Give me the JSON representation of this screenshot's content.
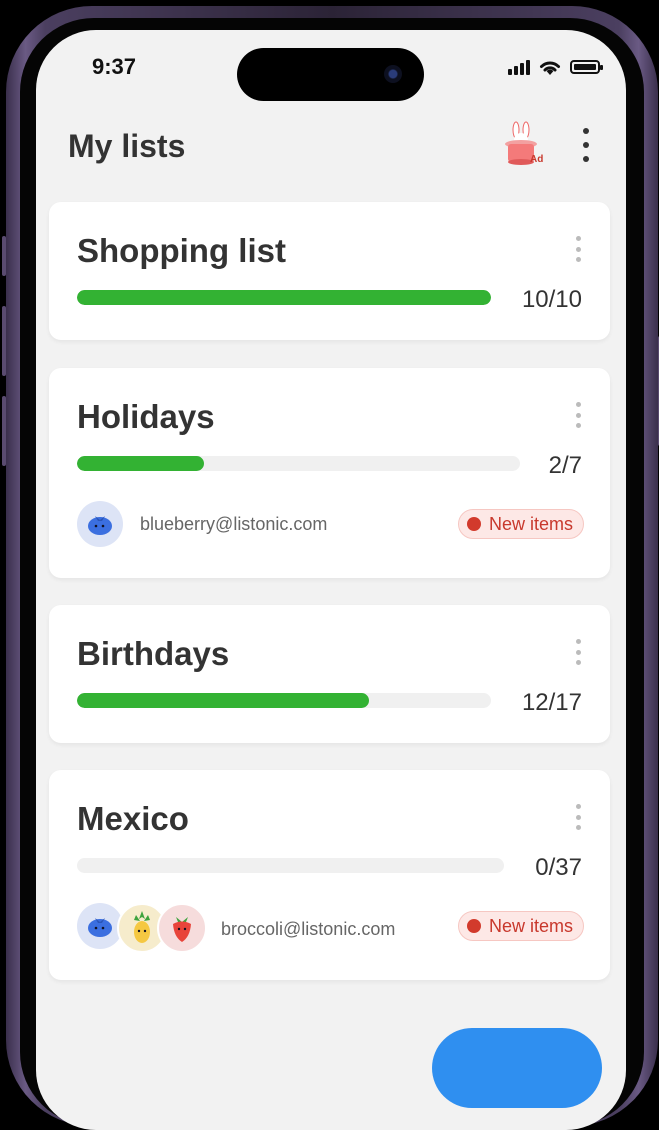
{
  "status_bar": {
    "time": "9:37"
  },
  "header": {
    "title": "My lists",
    "ad_label": "Ad"
  },
  "lists": [
    {
      "title": "Shopping list",
      "done": 10,
      "total": 10,
      "count": "10/10",
      "progress": 1.0
    },
    {
      "title": "Holidays",
      "done": 2,
      "total": 7,
      "count": "2/7",
      "progress": 0.2857,
      "shared_email": "blueberry@listonic.com",
      "badge": "New items",
      "avatars": [
        "blueberry-avatar"
      ]
    },
    {
      "title": "Birthdays",
      "done": 12,
      "total": 17,
      "count": "12/17",
      "progress": 0.7059
    },
    {
      "title": "Mexico",
      "done": 0,
      "total": 37,
      "count": "0/37",
      "progress": 0.0,
      "shared_email": "broccoli@listonic.com",
      "badge": "New items",
      "avatars": [
        "blueberry-avatar",
        "pineapple-avatar",
        "strawberry-avatar"
      ]
    }
  ],
  "colors": {
    "progress_fill": "#33b233",
    "progress_track": "#f0f0f0",
    "badge_text": "#c8382c",
    "badge_bg": "#fde8e6",
    "fab": "#2f8ff0",
    "background": "#f2f2f2"
  },
  "icons": {
    "ad": "magic-hat-bunny-icon",
    "more": "vertical-ellipsis-icon",
    "signal": "signal-bars-icon",
    "wifi": "wifi-icon",
    "battery": "battery-icon"
  }
}
